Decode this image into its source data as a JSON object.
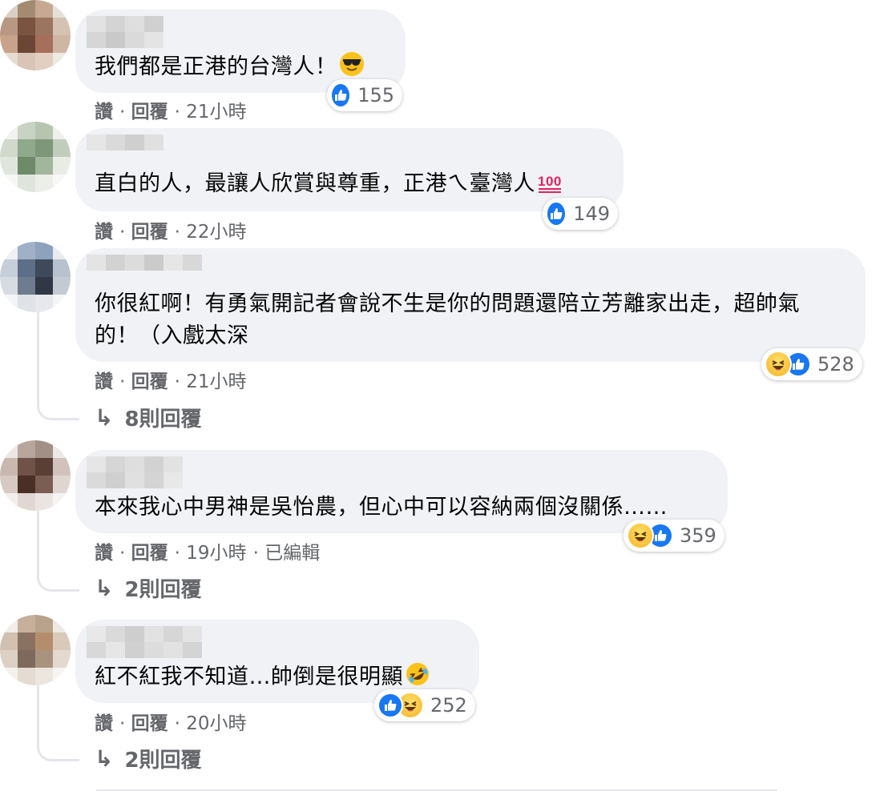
{
  "comments": [
    {
      "text": "我們都是正港的台灣人！",
      "inline_emoji": "smiling-face-with-sunglasses",
      "reaction_count": "155",
      "reactions": [
        "like"
      ],
      "like_label": "讚",
      "reply_label": "回覆",
      "time": "21小時",
      "edited": ""
    },
    {
      "text": "直白的人，最讓人欣賞與尊重，正港ㄟ臺灣人",
      "inline_emoji": "hundred-points",
      "reaction_count": "149",
      "reactions": [
        "like"
      ],
      "like_label": "讚",
      "reply_label": "回覆",
      "time": "22小時",
      "edited": ""
    },
    {
      "text": "你很紅啊！有勇氣開記者會說不生是你的問題還陪立芳離家出走，超帥氣的！（入戲太深",
      "inline_emoji": "",
      "reaction_count": "528",
      "reactions": [
        "haha",
        "like"
      ],
      "like_label": "讚",
      "reply_label": "回覆",
      "time": "21小時",
      "edited": "",
      "replies_label": "8則回覆"
    },
    {
      "text": "本來我心中男神是吳怡農，但心中可以容納兩個沒關係……",
      "inline_emoji": "",
      "reaction_count": "359",
      "reactions": [
        "haha",
        "like"
      ],
      "like_label": "讚",
      "reply_label": "回覆",
      "time": "19小時",
      "edited": "已編輯",
      "replies_label": "2則回覆"
    },
    {
      "text": "紅不紅我不知道…帥倒是很明顯",
      "inline_emoji": "rolling-on-floor-laughing",
      "reaction_count": "252",
      "reactions": [
        "like",
        "haha"
      ],
      "like_label": "讚",
      "reply_label": "回覆",
      "time": "20小時",
      "edited": "",
      "replies_label": "2則回覆"
    }
  ],
  "colors": {
    "bubble": "#f0f2f5",
    "like_blue": "#1877f2",
    "meta_gray": "#65676b"
  }
}
